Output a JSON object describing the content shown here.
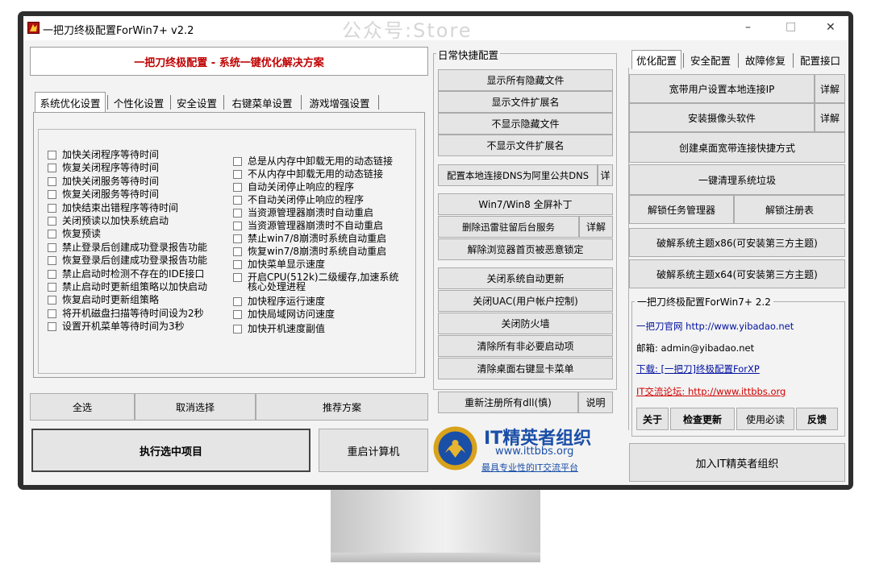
{
  "window": {
    "title": "一把刀终极配置ForWin7+ v2.2",
    "watermark": "公众号:Store",
    "controls": [
      "–",
      "□",
      "✕"
    ]
  },
  "left": {
    "banner": "一把刀终极配置 - 系统一键优化解决方案",
    "tabs": [
      "系统优化设置",
      "个性化设置",
      "安全设置",
      "右键菜单设置",
      "游戏增强设置"
    ],
    "col1": [
      "加快关闭程序等待时间",
      "恢复关闭程序等待时间",
      "加快关闭服务等待时间",
      "恢复关闭服务等待时间",
      "加快结束出错程序等待时间",
      "关闭预读以加快系统启动",
      "恢复预读",
      "禁止登录后创建成功登录报告功能",
      "恢复登录后创建成功登录报告功能",
      "禁止启动时检测不存在的IDE接口",
      "禁止启动时更新组策略以加快启动",
      "恢复启动时更新组策略",
      "将开机磁盘扫描等待时间设为2秒",
      "设置开机菜单等待时间为3秒"
    ],
    "col2": [
      "总是从内存中卸载无用的动态链接",
      "不从内存中卸载无用的动态链接",
      "自动关闭停止响应的程序",
      "不自动关闭停止响应的程序",
      "当资源管理器崩溃时自动重启",
      "当资源管理器崩溃时不自动重启",
      "禁止win7/8崩溃时系统自动重启",
      "恢复win7/8崩溃时系统自动重启",
      "加快菜单显示速度",
      "开启CPU(512k)二级缓存,加速系统",
      "核心处理进程",
      "加快程序运行速度",
      "加快局域网访问速度",
      "加快开机速度副值"
    ],
    "select_all": "全选",
    "deselect": "取消选择",
    "recommend": "推荐方案",
    "execute": "执行选中项目",
    "restart": "重启计算机"
  },
  "middle": {
    "group_title": "日常快捷配置",
    "btns_a": [
      "显示所有隐藏文件",
      "显示文件扩展名",
      "不显示隐藏文件",
      "不显示文件扩展名"
    ],
    "dns": "配置本地连接DNS为阿里公共DNS",
    "dns_detail": "详",
    "win_patch": "Win7/Win8 全屏补丁",
    "xunlei": "删除迅雷驻留后台服务",
    "xunlei_detail": "详解",
    "browser": "解除浏览器首页被恶意锁定",
    "btns_b": [
      "关闭系统自动更新",
      "关闭UAC(用户帐户控制)",
      "关闭防火墙",
      "清除所有非必要启动项",
      "清除桌面右键显卡菜单"
    ],
    "reg_dll": "重新注册所有dll(慎)",
    "explain": "说明",
    "logo_title": "IT精英者组织",
    "logo_url": "www.ittbbs.org",
    "logo_slogan": "最具专业性的IT交流平台"
  },
  "right": {
    "tabs": [
      "优化配置",
      "安全配置",
      "故障修复",
      "配置接口"
    ],
    "broadband_ip": "宽带用户设置本地连接IP",
    "camera": "安装摄像头软件",
    "detail": "详解",
    "shortcut": "创建桌面宽带连接快捷方式",
    "cleanup": "一键清理系统垃圾",
    "unlock_task": "解锁任务管理器",
    "unlock_reg": "解锁注册表",
    "theme_x86": "破解系统主题x86(可安装第三方主题)",
    "theme_x64": "破解系统主题x64(可安装第三方主题)",
    "info_title": "一把刀终极配置ForWin7+ 2.2",
    "site": "一把刀官网 http://www.yibadao.net",
    "email": "邮箱: admin@yibadao.net",
    "download": "下载: [一把刀]终极配置ForXP",
    "forum": "IT交流论坛: http://www.ittbbs.org",
    "about": "关于",
    "check_update": "检查更新",
    "must_read": "使用必读",
    "feedback": "反馈",
    "join": "加入IT精英者组织"
  },
  "colors": {
    "banner_text": "#c00000",
    "link_blue": "#0010a0",
    "forum_red": "#d00000",
    "logo_blue": "#1a4fa8",
    "gold": "#d9a21b"
  }
}
